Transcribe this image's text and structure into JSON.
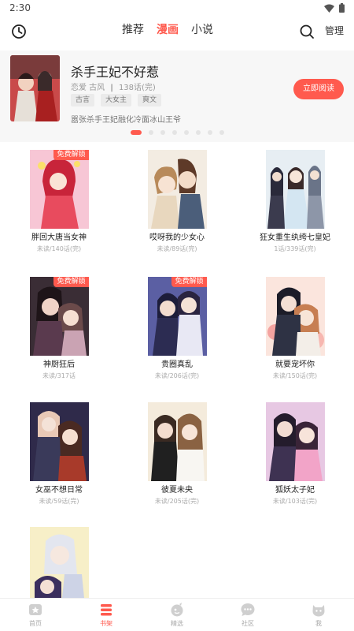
{
  "status_bar": {
    "time": "2:30"
  },
  "top_nav": {
    "tabs": [
      {
        "label": "推荐",
        "active": false
      },
      {
        "label": "漫画",
        "active": true
      },
      {
        "label": "小说",
        "active": false
      }
    ],
    "manage_label": "管理"
  },
  "banner": {
    "title": "杀手王妃不好惹",
    "genres": "恋爱 古风",
    "chapters": "138话(完)",
    "tags": [
      "古言",
      "大女主",
      "爽文"
    ],
    "description": "嚣张杀手王妃融化冷面冰山王爷",
    "read_button": "立即阅读",
    "slide_count": 8,
    "active_slide": 0
  },
  "grid": {
    "items": [
      {
        "title": "胖回大唐当女神",
        "progress": "未读/140话(完)",
        "badge": "免费解锁"
      },
      {
        "title": "哎呀我的少女心",
        "progress": "未读/89话(完)",
        "badge": ""
      },
      {
        "title": "狂女重生纨绔七皇妃",
        "progress": "1话/339话(完)",
        "badge": ""
      },
      {
        "title": "神厨狂后",
        "progress": "未读/317话",
        "badge": "免费解锁"
      },
      {
        "title": "贵圈真乱",
        "progress": "未读/206话(完)",
        "badge": "免费解锁"
      },
      {
        "title": "就要宠坏你",
        "progress": "未读/150话(完)",
        "badge": ""
      },
      {
        "title": "女巫不想日常",
        "progress": "未读/59话(完)",
        "badge": ""
      },
      {
        "title": "彼夏未央",
        "progress": "未读/205话(完)",
        "badge": ""
      },
      {
        "title": "狐妖太子妃",
        "progress": "未读/103话(完)",
        "badge": ""
      },
      {
        "title": "",
        "progress": "",
        "badge": ""
      }
    ]
  },
  "bottom_nav": {
    "items": [
      {
        "label": "首页",
        "icon": "home-icon",
        "active": false
      },
      {
        "label": "书架",
        "icon": "bookshelf-icon",
        "active": true
      },
      {
        "label": "精选",
        "icon": "featured-icon",
        "active": false
      },
      {
        "label": "社区",
        "icon": "community-icon",
        "active": false
      },
      {
        "label": "我",
        "icon": "profile-icon",
        "active": false
      }
    ]
  },
  "colors": {
    "accent": "#ff5a4e",
    "text": "#222222",
    "muted": "#aaaaaa",
    "banner_bg": "#f7f7f7"
  }
}
